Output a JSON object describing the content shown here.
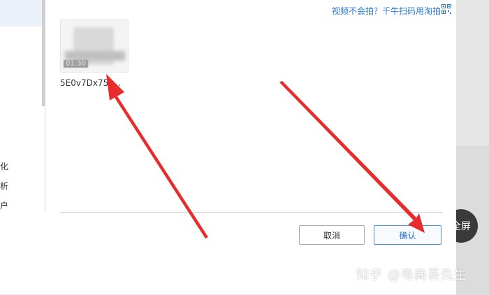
{
  "help": {
    "link_text": "视频不会拍？千牛扫码用淘拍"
  },
  "sidebar": {
    "items": [
      {
        "label": "化"
      },
      {
        "label": "析"
      },
      {
        "label": "户"
      }
    ]
  },
  "file": {
    "name": "5E0v7Dx75s...",
    "badge": "01:30"
  },
  "buttons": {
    "cancel_label": "取消",
    "confirm_label": "确认"
  },
  "page": {
    "fullscreen_label": "全屏",
    "watermark": "知乎 @电商吾先生"
  },
  "colors": {
    "accent": "#2a7ad3",
    "arrow": "#e82b2b"
  }
}
